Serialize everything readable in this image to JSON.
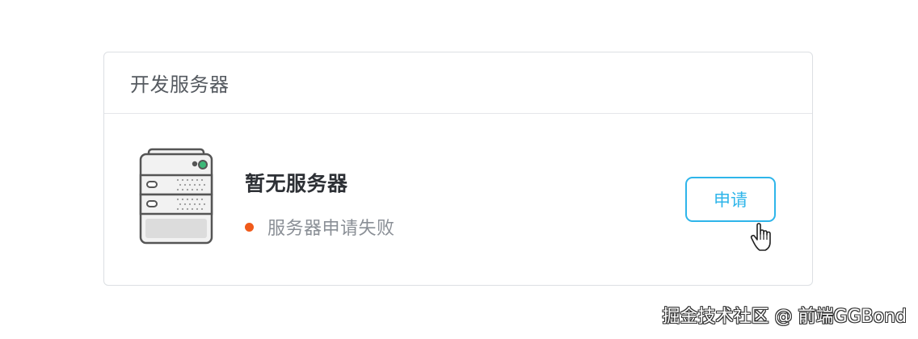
{
  "card": {
    "title": "开发服务器"
  },
  "server": {
    "icon": "server-rack-icon",
    "title": "暂无服务器",
    "status": {
      "text": "服务器申请失败",
      "color": "#f05a1a"
    }
  },
  "actions": {
    "apply_label": "申请",
    "accent_color": "#2eb5ea"
  },
  "cursor": {
    "icon": "hand-pointer-icon"
  },
  "watermark": {
    "text": "掘金技术社区 @ 前端GGBond"
  }
}
